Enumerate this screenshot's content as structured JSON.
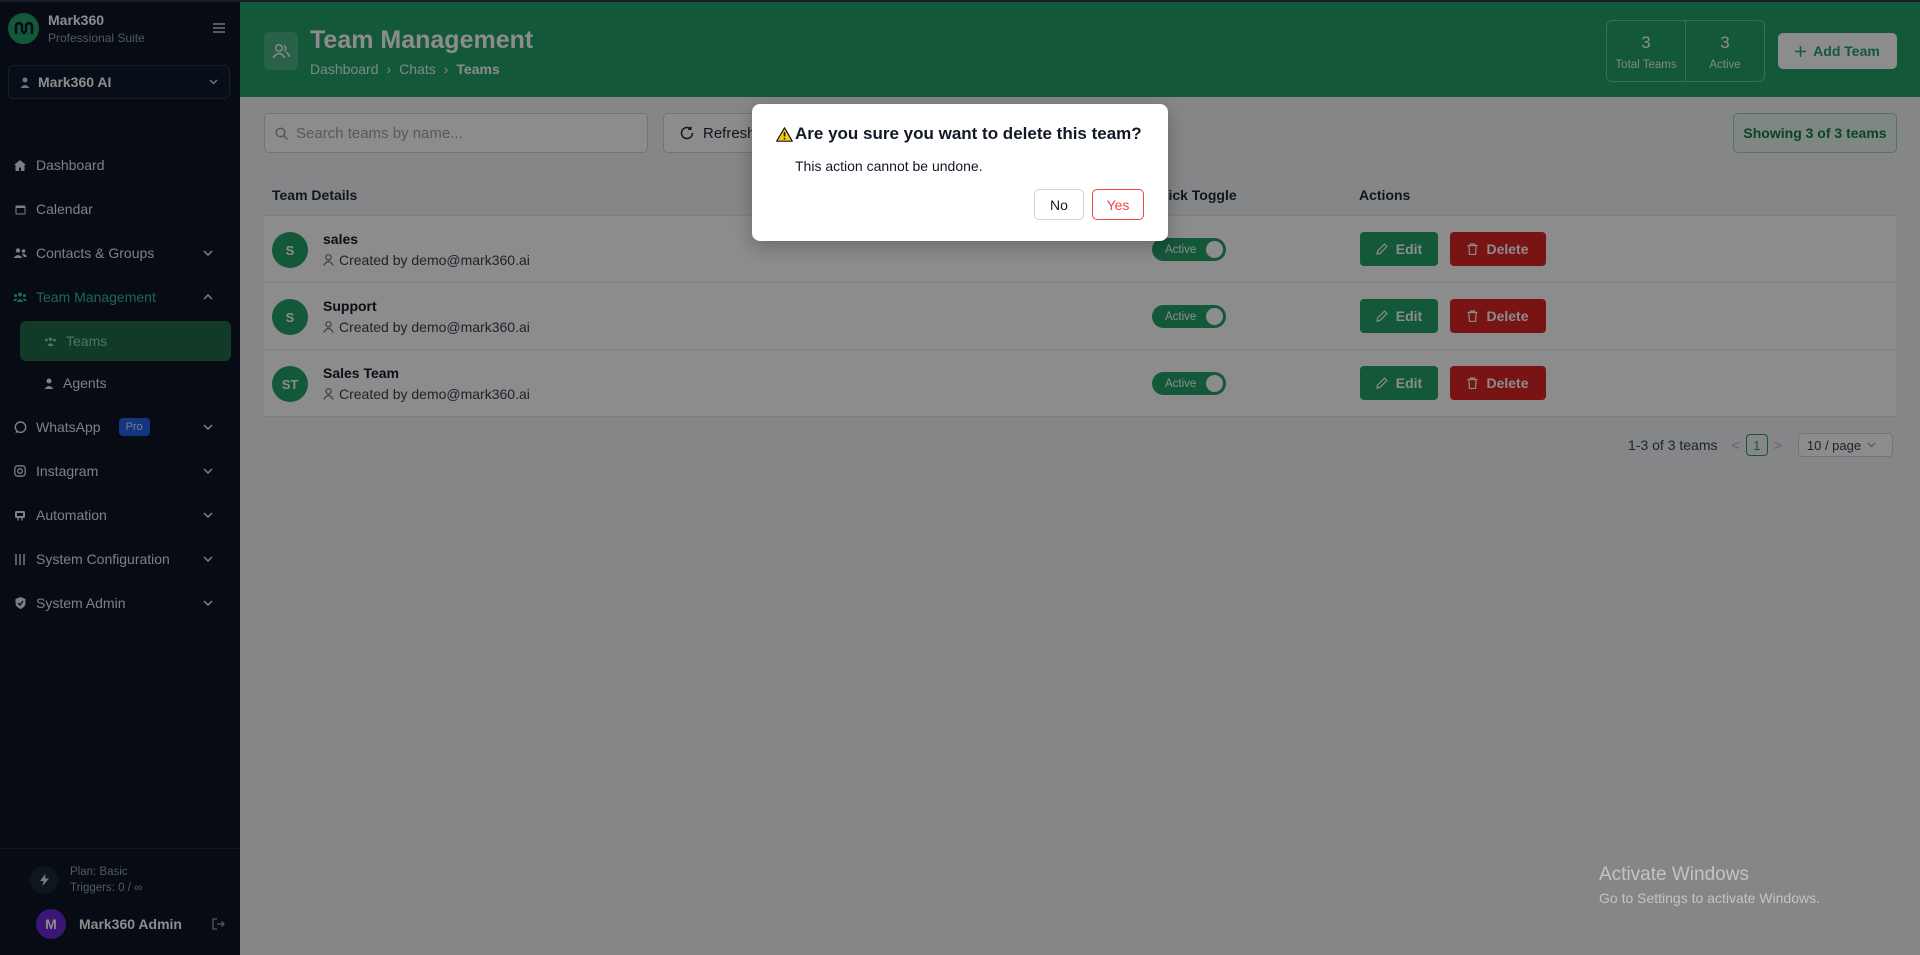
{
  "brand": {
    "name": "Mark360",
    "subtitle": "Professional Suite"
  },
  "account": {
    "label": "Mark360 AI"
  },
  "nav": {
    "dashboard": "Dashboard",
    "calendar": "Calendar",
    "contacts": "Contacts & Groups",
    "team_management": "Team Management",
    "teams": "Teams",
    "agents": "Agents",
    "whatsapp": "WhatsApp",
    "whatsapp_badge": "Pro",
    "instagram": "Instagram",
    "automation": "Automation",
    "system_configuration": "System Configuration",
    "system_admin": "System Admin"
  },
  "footer": {
    "plan": "Plan: Basic",
    "triggers": "Triggers: 0 / ∞",
    "user_name": "Mark360 Admin",
    "user_initial": "M"
  },
  "header": {
    "title": "Team Management",
    "breadcrumb": [
      "Dashboard",
      "Chats",
      "Teams"
    ],
    "stats": {
      "total_value": "3",
      "total_label": "Total Teams",
      "active_value": "3",
      "active_label": "Active"
    },
    "add_button": "Add Team"
  },
  "toolbar": {
    "search_placeholder": "Search teams by name...",
    "refresh": "Refresh",
    "showing": "Showing 3 of 3 teams"
  },
  "table": {
    "headers": {
      "details": "Team Details",
      "toggle": "Quick Toggle",
      "actions": "Actions"
    },
    "rows": [
      {
        "initials": "S",
        "name": "sales",
        "creator": "Created by demo@mark360.ai",
        "status": "Active"
      },
      {
        "initials": "S",
        "name": "Support",
        "creator": "Created by demo@mark360.ai",
        "status": "Active"
      },
      {
        "initials": "ST",
        "name": "Sales Team",
        "creator": "Created by demo@mark360.ai",
        "status": "Active"
      }
    ],
    "edit_label": "Edit",
    "delete_label": "Delete"
  },
  "pagination": {
    "range": "1-3 of 3 teams",
    "prev": "<",
    "current": "1",
    "next": ">",
    "page_size": "10 / page"
  },
  "dialog": {
    "title": "Are you sure you want to delete this team?",
    "message": "This action cannot be undone.",
    "no": "No",
    "yes": "Yes"
  },
  "watermark": {
    "line1": "Activate Windows",
    "line2": "Go to Settings to activate Windows."
  },
  "colors": {
    "brand_green": "#25a06b",
    "sidebar_bg": "#0b1526",
    "danger": "#dc2626",
    "pro_badge": "#2563eb"
  }
}
